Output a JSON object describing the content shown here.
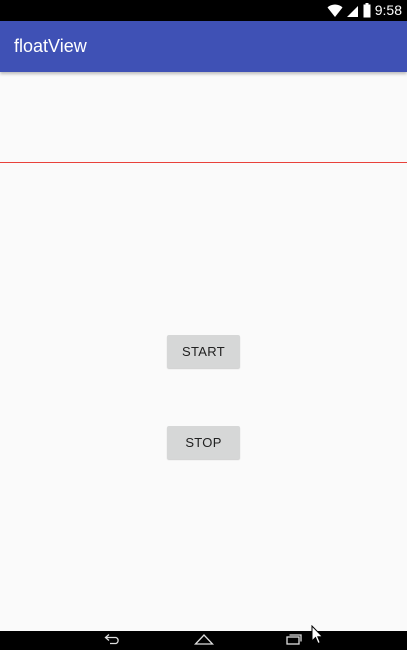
{
  "status_bar": {
    "time": "9:58",
    "icons": [
      "wifi-icon",
      "signal-icon",
      "battery-icon"
    ]
  },
  "app_bar": {
    "title": "floatView",
    "color": "#3f51b5"
  },
  "content": {
    "divider_color": "#e8413a",
    "start_label": "START",
    "stop_label": "STOP"
  },
  "nav_bar": {
    "buttons": [
      "back-icon",
      "home-icon",
      "recents-icon"
    ]
  }
}
